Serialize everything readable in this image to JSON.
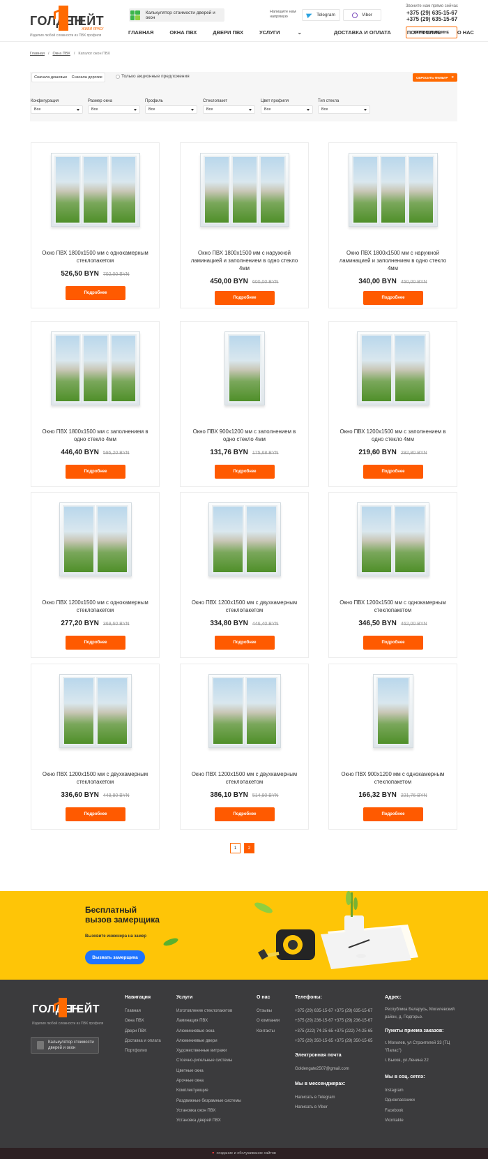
{
  "header": {
    "logo": {
      "left": "ГОЛДЕН",
      "right": "ГЕЙТ",
      "sub": "ЖИВИ ЯРКО!",
      "tagline": "Изделия любой сложности из ПВХ профиля"
    },
    "calculator_label": "Калькулятор стоимости дверей и окон",
    "messenger_label": "Напишите нам напрямую",
    "telegram": "Telegram",
    "viber": "Viber",
    "call_label": "Звоните нам прямо сейчас",
    "phones": [
      "+375 (29) 635-15-67",
      "+375 (29) 635-15-67"
    ],
    "callback": "ПЕРЕЗВОНИТЕ МНЕ"
  },
  "nav": [
    "ГЛАВНАЯ",
    "ОКНА ПВХ",
    "ДВЕРИ ПВХ",
    "УСЛУГИ",
    "ДОСТАВКА И ОПЛАТА",
    "ПОРТФОЛИО",
    "О НАС"
  ],
  "breadcrumbs": [
    "Главная",
    "Окна ПВХ",
    "Каталог окон ПВХ"
  ],
  "filters": {
    "sort_cheap": "Сначала дешевые",
    "sort_expensive": "Сначала дорогие",
    "promo_only": "Только акционные предложения",
    "reset": "СБРОСИТЬ ФИЛЬТР",
    "groups": [
      {
        "label": "Конфигурация",
        "value": "Все"
      },
      {
        "label": "Размер окна",
        "value": "Все"
      },
      {
        "label": "Профиль",
        "value": "Все"
      },
      {
        "label": "Стеклопакет",
        "value": "Все"
      },
      {
        "label": "Цвет профиля",
        "value": "Все"
      },
      {
        "label": "Тип стекла",
        "value": "Все"
      }
    ]
  },
  "products": [
    {
      "title": "Окно ПВХ 1800х1500 мм с однокамерным стеклопакетом",
      "price": "526,50 BYN",
      "old_price": "702,00 BYN",
      "panes": 3
    },
    {
      "title": "Окно ПВХ 1800х1500 мм с наружной ламинацией и заполнением в одно стекло 4мм",
      "price": "450,00 BYN",
      "old_price": "600,00 BYN",
      "panes": 3
    },
    {
      "title": "Окно ПВХ 1800х1500 мм с наружной ламинацией и заполнением в одно стекло 4мм",
      "price": "340,00 BYN",
      "old_price": "450,00 BYN",
      "panes": 3
    },
    {
      "title": "Окно ПВХ 1800х1500 мм с заполнением в одно стекло 4мм",
      "price": "446,40 BYN",
      "old_price": "595,20 BYN",
      "panes": 3
    },
    {
      "title": "Окно ПВХ 900х1200 мм с заполнением в одно стекло 4мм",
      "price": "131,76 BYN",
      "old_price": "175,68 BYN",
      "panes": 1
    },
    {
      "title": "Окно ПВХ 1200х1500 мм с заполнением в одно стекло 4мм",
      "price": "219,60 BYN",
      "old_price": "292,80 BYN",
      "panes": 2
    },
    {
      "title": "Окно ПВХ 1200х1500 мм с однокамерным стеклопакетом",
      "price": "277,20 BYN",
      "old_price": "369,60 BYN",
      "panes": 2
    },
    {
      "title": "Окно ПВХ 1200х1500 мм с двухкамерным стеклопакетом",
      "price": "334,80 BYN",
      "old_price": "446,40 BYN",
      "panes": 2
    },
    {
      "title": "Окно ПВХ 1200х1500 мм с однокамерным стеклопакетом",
      "price": "346,50 BYN",
      "old_price": "462,00 BYN",
      "panes": 2
    },
    {
      "title": "Окно ПВХ 1200х1500 мм с двухкамерным стеклопакетом",
      "price": "336,60 BYN",
      "old_price": "448,80 BYN",
      "panes": 2
    },
    {
      "title": "Окно ПВХ 1200х1500 мм с двухкамерным стеклопакетом",
      "price": "386,10 BYN",
      "old_price": "514,80 BYN",
      "panes": 2
    },
    {
      "title": "Окно ПВХ 900х1200 мм с однокамерным стеклопакетом",
      "price": "166,32 BYN",
      "old_price": "221,76 BYN",
      "panes": 1
    }
  ],
  "details_label": "Подробнее",
  "pagination": [
    "1",
    "2"
  ],
  "banner": {
    "title": "Бесплатный вызов замерщика",
    "subtitle": "Вызовите инженера на замер",
    "button": "Вызвать замерщика"
  },
  "footer": {
    "calculator": "Калькулятор стоимости дверей и окон",
    "navigation": {
      "title": "Навигация",
      "items": [
        "Главная",
        "Окна ПВХ",
        "Двери ПВХ",
        "Доставка и оплата",
        "Портфолио"
      ]
    },
    "services": {
      "title": "Услуги",
      "items": [
        "Изготовление стеклопакетов",
        "Ламинация ПВХ",
        "Алюминиевые окна",
        "Алюминиевые двери",
        "Художественные витражи",
        "Стоечно-ригельные системы",
        "Цветные окна",
        "Арочные окна",
        "Комплектующие",
        "Раздвижные безрамные системы",
        "Установка окон ПВХ",
        "Установка дверей ПВХ"
      ]
    },
    "about": {
      "title": "О нас",
      "items": [
        "Отзывы",
        "О компании",
        "Контакты"
      ]
    },
    "phones": {
      "title": "Телефоны:",
      "items": [
        "+375 (29) 635-15-67 +375 (29) 635-15-67",
        "+375 (29) 236-15-67 +375 (29) 236-15-67",
        "+375 (222) 74-25-65 +375 (222) 74-25-65",
        "+375 (29) 350-15-65 +375 (29) 350-15-65"
      ]
    },
    "email": {
      "title": "Электронная почта",
      "value": "Goldengate2507@gmail.com"
    },
    "messengers": {
      "title": "Мы в мессенджерах:",
      "items": [
        "Написать в Telegram",
        "Написать в Viber"
      ]
    },
    "address": {
      "title": "Адрес:",
      "value": "Республика Беларусь, Могилевский район, д. Подгорье."
    },
    "points": {
      "title": "Пункты приема заказов:",
      "items": [
        "г. Могилев, ул Строителей 33 (ТЦ \"Палас\")",
        "г. Быхов, ул.Ленина 22"
      ]
    },
    "social": {
      "title": "Мы в соц. сетях:",
      "items": [
        "Instagram",
        "Одноклассники",
        "Facebook",
        "Vkontakte"
      ]
    },
    "credit": "создание и обслуживание сайтов"
  }
}
